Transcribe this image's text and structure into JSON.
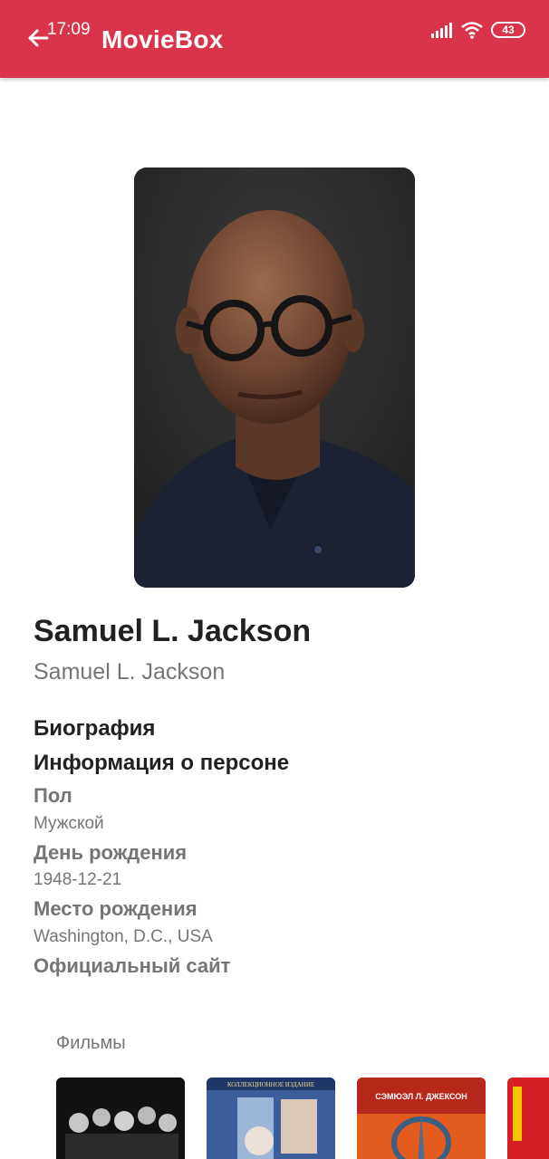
{
  "status_bar": {
    "time": "17:09",
    "battery": "43"
  },
  "app_bar": {
    "title": "MovieBox",
    "back_icon": "arrow-left-icon"
  },
  "person": {
    "name": "Samuel L. Jackson",
    "original_name": "Samuel L. Jackson"
  },
  "sections": {
    "biography": "Биография",
    "info": "Информация о персоне"
  },
  "fields": {
    "gender_label": "Пол",
    "gender_value": "Мужской",
    "birthday_label": "День рождения",
    "birthday_value": "1948-12-21",
    "birthplace_label": "Место рождения",
    "birthplace_value": "Washington, D.C., USA",
    "website_label": "Официальный сайт"
  },
  "films": {
    "label": "Фильмы",
    "posters": [
      {
        "caption": ""
      },
      {
        "caption": "КОЛЛЕКЦИОННОЕ ИЗДАНИЕ"
      },
      {
        "caption": "СЭМЮЭЛ Л. ДЖЕКСОН"
      }
    ]
  },
  "colors": {
    "primary": "#d9344a",
    "text_primary": "#212121",
    "text_secondary": "#757575"
  }
}
